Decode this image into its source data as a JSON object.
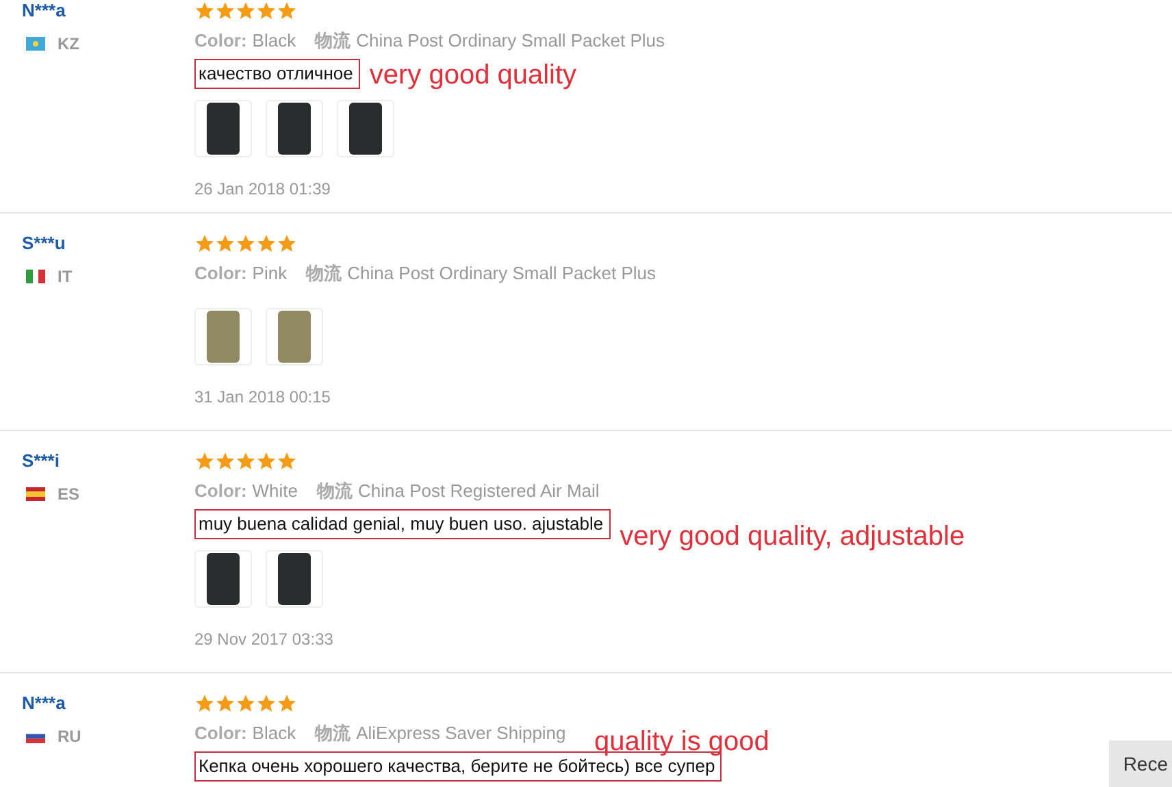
{
  "reviews": [
    {
      "name": "N***a",
      "country": "KZ",
      "flag": {
        "kind": "kz"
      },
      "stars": 5,
      "color_label": "Color:",
      "variant": "Black",
      "shipping_label": "物流",
      "shipping": "China Post Ordinary Small Packet Plus",
      "comment": "качество отличное",
      "note": "very good quality",
      "photos": [
        {
          "kind": "dark"
        },
        {
          "kind": "dark"
        },
        {
          "kind": "dark"
        }
      ],
      "date": "26 Jan 2018 01:39"
    },
    {
      "name": "S***u",
      "country": "IT",
      "flag": {
        "kind": "it"
      },
      "stars": 5,
      "color_label": "Color:",
      "variant": "Pink",
      "shipping_label": "物流",
      "shipping": "China Post Ordinary Small Packet Plus",
      "photos": [
        {
          "kind": "light"
        },
        {
          "kind": "light"
        }
      ],
      "date": "31 Jan 2018 00:15"
    },
    {
      "name": "S***i",
      "country": "ES",
      "flag": {
        "kind": "es"
      },
      "stars": 5,
      "color_label": "Color:",
      "variant": "White",
      "shipping_label": "物流",
      "shipping": "China Post Registered Air Mail",
      "comment": "muy buena calidad genial, muy buen uso. ajustable",
      "note": "very good quality, adjustable",
      "photos": [
        {
          "kind": "dark"
        },
        {
          "kind": "dark"
        }
      ],
      "date": "29 Nov 2017 03:33"
    },
    {
      "name": "N***a",
      "country": "RU",
      "flag": {
        "kind": "ru"
      },
      "stars": 5,
      "color_label": "Color:",
      "variant": "Black",
      "shipping_label": "物流",
      "shipping": "AliExpress Saver Shipping",
      "comment": "Кепка очень хорошего качества, берите не бойтесь) все супер",
      "note": "quality is good",
      "note_above": true
    }
  ],
  "corner_button": {
    "label": "Rece"
  }
}
